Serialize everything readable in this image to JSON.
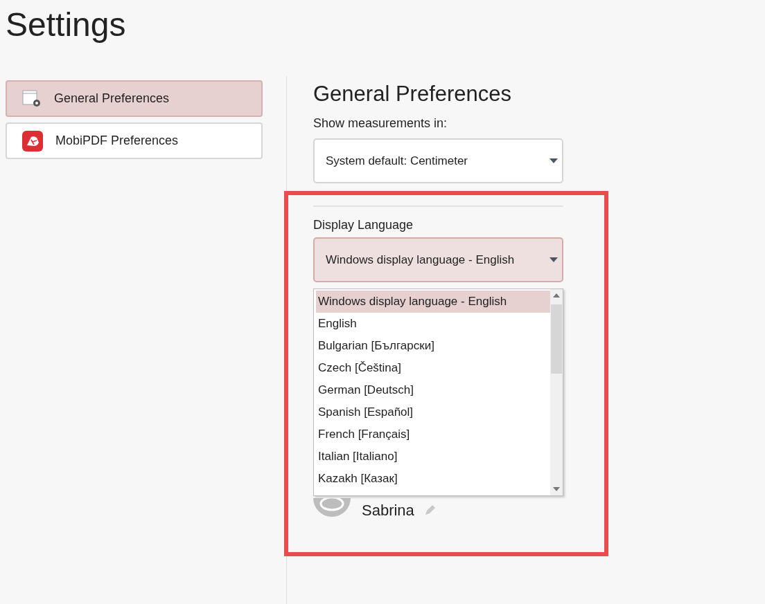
{
  "title": "Settings",
  "sidebar": {
    "items": [
      {
        "label": "General Preferences",
        "kind": "general",
        "selected": true
      },
      {
        "label": "MobiPDF Preferences",
        "kind": "app",
        "selected": false
      }
    ]
  },
  "content": {
    "heading": "General Preferences",
    "measurements": {
      "label": "Show measurements in:",
      "value": "System default: Centimeter"
    },
    "language": {
      "label": "Display Language",
      "value": "Windows display language - English",
      "expanded": true,
      "options": [
        {
          "label": "Windows display language - English",
          "selected": true
        },
        {
          "label": "English",
          "selected": false
        },
        {
          "label": "Bulgarian [Български]",
          "selected": false
        },
        {
          "label": "Czech [Čeština]",
          "selected": false
        },
        {
          "label": "German [Deutsch]",
          "selected": false
        },
        {
          "label": "Spanish [Español]",
          "selected": false
        },
        {
          "label": "French [Français]",
          "selected": false
        },
        {
          "label": "Italian [Italiano]",
          "selected": false
        },
        {
          "label": "Kazakh [Казак]",
          "selected": false
        }
      ]
    },
    "user": {
      "name": "Sabrina"
    }
  }
}
